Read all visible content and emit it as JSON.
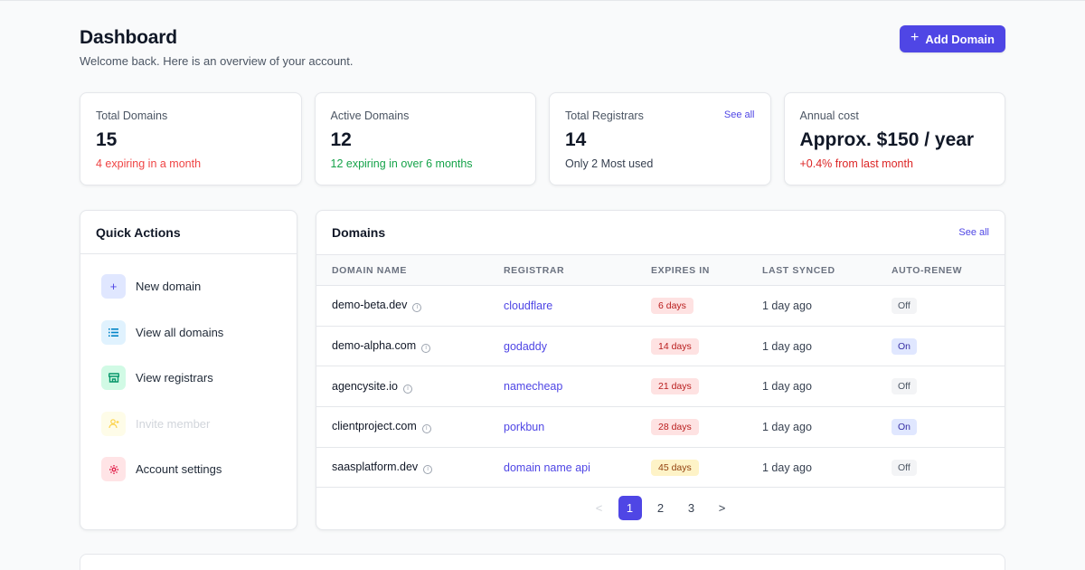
{
  "header": {
    "title": "Dashboard",
    "subtitle": "Welcome back. Here is an overview of your account.",
    "add_button_label": "Add Domain",
    "add_button_icon": "plus-icon"
  },
  "stats": [
    {
      "label": "Total Domains",
      "value": "15",
      "note": "4 expiring in a month",
      "note_color": "#ef4444"
    },
    {
      "label": "Active Domains",
      "value": "12",
      "note": "12 expiring in over 6 months",
      "note_color": "#16a34a"
    },
    {
      "label": "Total Registrars",
      "value": "14",
      "note": "Only 2 Most used",
      "note_color": "#374151",
      "link": "See all"
    },
    {
      "label": "Annual cost",
      "value": "Approx. $150 / year",
      "note": "+0.4% from last month",
      "note_color": "#dc2626"
    }
  ],
  "quick_actions": {
    "title": "Quick Actions",
    "items": [
      {
        "label": "New domain",
        "icon": "plus-icon",
        "enabled": true
      },
      {
        "label": "View all domains",
        "icon": "list-icon",
        "enabled": true
      },
      {
        "label": "View registrars",
        "icon": "store-icon",
        "enabled": true
      },
      {
        "label": "Invite member",
        "icon": "user-plus-icon",
        "enabled": false
      },
      {
        "label": "Account settings",
        "icon": "gear-icon",
        "enabled": true
      }
    ]
  },
  "domains": {
    "title": "Domains",
    "see_all": "See all",
    "columns": [
      "DOMAIN NAME",
      "REGISTRAR",
      "EXPIRES IN",
      "LAST SYNCED",
      "AUTO-RENEW"
    ],
    "rows": [
      {
        "name": "demo-beta.dev",
        "registrar": "cloudflare",
        "expires": "6 days",
        "expires_level": "red",
        "synced": "1 day ago",
        "auto_renew": "Off"
      },
      {
        "name": "demo-alpha.com",
        "registrar": "godaddy",
        "expires": "14 days",
        "expires_level": "red",
        "synced": "1 day ago",
        "auto_renew": "On"
      },
      {
        "name": "agencysite.io",
        "registrar": "namecheap",
        "expires": "21 days",
        "expires_level": "red",
        "synced": "1 day ago",
        "auto_renew": "Off"
      },
      {
        "name": "clientproject.com",
        "registrar": "porkbun",
        "expires": "28 days",
        "expires_level": "red",
        "synced": "1 day ago",
        "auto_renew": "On"
      },
      {
        "name": "saasplatform.dev",
        "registrar": "domain name api",
        "expires": "45 days",
        "expires_level": "yellow",
        "synced": "1 day ago",
        "auto_renew": "Off"
      }
    ],
    "pagination": {
      "prev": "<",
      "pages": [
        "1",
        "2",
        "3"
      ],
      "current": "1",
      "next": ">"
    }
  },
  "colors": {
    "accent": "#4f46e5"
  }
}
